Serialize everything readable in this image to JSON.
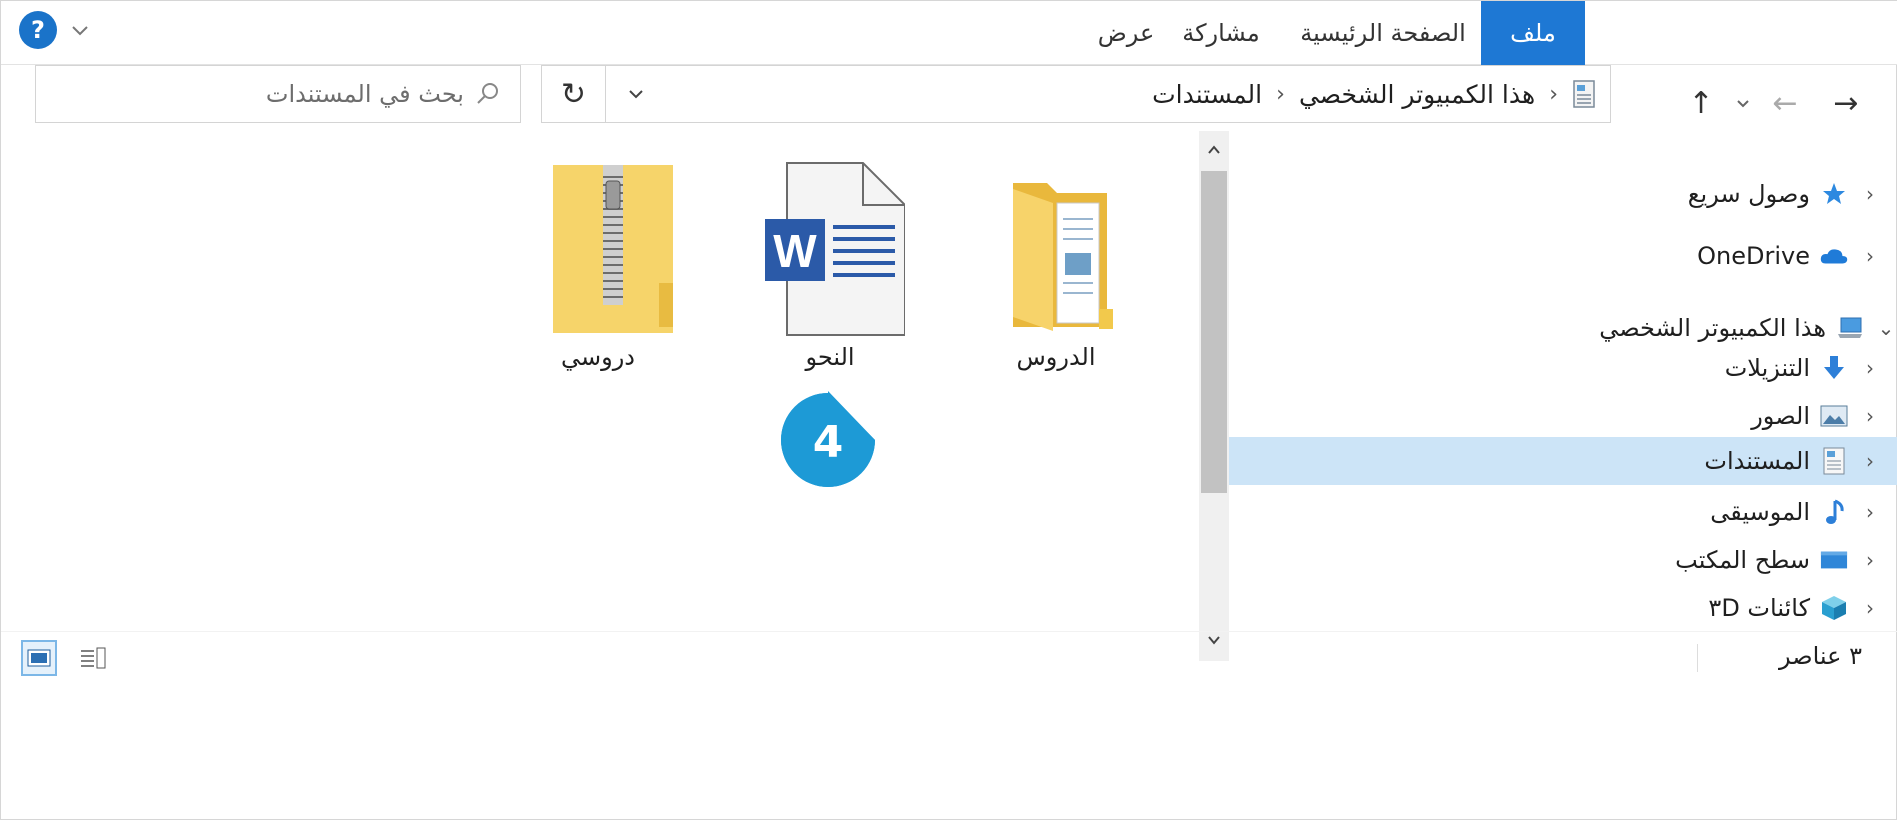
{
  "ribbon": {
    "tabs": [
      {
        "id": "file",
        "label": "ملف"
      },
      {
        "id": "home",
        "label": "الصفحة الرئيسية"
      },
      {
        "id": "share",
        "label": "مشاركة"
      },
      {
        "id": "view",
        "label": "عرض"
      }
    ],
    "help_label": "?"
  },
  "address": {
    "crumbs": [
      "هذا الكمبيوتر الشخصي",
      "المستندات"
    ]
  },
  "search": {
    "placeholder": "بحث في المستندات"
  },
  "navpane": {
    "items": [
      {
        "label": "وصول سريع",
        "icon": "star-icon"
      },
      {
        "label": "OneDrive",
        "icon": "cloud-icon"
      },
      {
        "label": "هذا الكمبيوتر الشخصي",
        "icon": "computer-icon"
      },
      {
        "label": "التنزيلات",
        "icon": "download-icon"
      },
      {
        "label": "الصور",
        "icon": "pictures-icon"
      },
      {
        "label": "المستندات",
        "icon": "documents-icon"
      },
      {
        "label": "الموسيقى",
        "icon": "music-icon"
      },
      {
        "label": "سطح المكتب",
        "icon": "desktop-icon"
      },
      {
        "label": "كائنات ٣D",
        "icon": "3d-objects-icon"
      }
    ]
  },
  "files": [
    {
      "label": "الدروس",
      "icon": "folder-icon"
    },
    {
      "label": "النحو",
      "icon": "word-document-icon"
    },
    {
      "label": "دروسي",
      "icon": "zip-folder-icon"
    }
  ],
  "badge": {
    "number": "4"
  },
  "status": {
    "count": "٣ عناصر"
  },
  "colors": {
    "accent": "#1e78d4",
    "selection": "#cce4f7",
    "badge": "#1d9ad6"
  }
}
